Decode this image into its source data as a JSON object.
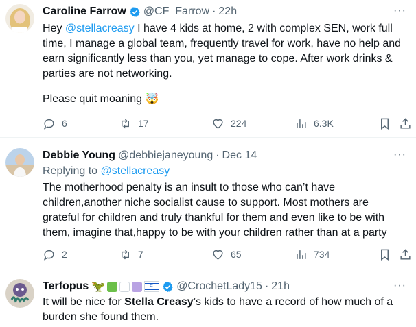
{
  "tweets": [
    {
      "name": "Caroline Farrow",
      "handle": "@CF_Farrow",
      "sep": "·",
      "time": "22h",
      "reply_to_prefix": "",
      "reply_to": "",
      "line_1_prefix": "Hey ",
      "line_1_mention": "@stellacreasy",
      "line_1_rest": " I have 4 kids at home, 2 with complex SEN, work full time, I manage a global team, frequently travel for work, have no help and earn significantly less than you, yet manage to cope. After work drinks & parties are not networking.",
      "line_2": "Please quit moaning",
      "line_2_emoji": "🤯",
      "replies": "6",
      "reposts": "17",
      "likes": "224",
      "views": "6.3K",
      "avatar_colors": [
        "#e8d9b0",
        "#c9a16a"
      ]
    },
    {
      "name": "Debbie Young",
      "handle": "@debbiejaneyoung",
      "sep": "·",
      "time": "Dec 14",
      "reply_to_prefix": "Replying to ",
      "reply_to": "@stellacreasy",
      "text": "The motherhood penalty is an insult to those who can’t have children,another niche socialist cause to support. Most mothers are grateful for children and truly thankful for them and even like to be with them, imagine that,happy to be with your children rather than at a party",
      "replies": "2",
      "reposts": "7",
      "likes": "65",
      "views": "734",
      "avatar_colors": [
        "#9bb9d8",
        "#e3c7a7"
      ]
    },
    {
      "name": "Terfopus",
      "name_emojis": [
        "🦖"
      ],
      "handle": "@CrochetLady15",
      "sep": "·",
      "time": "21h",
      "text_prefix": "It will be nice for ",
      "text_bold": "Stella Creasy",
      "text_rest": "’s kids to have a record of how much of a burden she found them.",
      "avatar_colors": [
        "#6b5a8e",
        "#2f7d6d"
      ]
    }
  ],
  "more_label": "···",
  "colors": {
    "accent": "#1d9bf0",
    "muted": "#536471",
    "text": "#0f1419",
    "divider": "#eff3f4",
    "name_square_1": "#6cc04a",
    "name_square_2": "#ffffff",
    "name_square_3": "#b9a3e3"
  },
  "icons": [
    "verified-badge-icon",
    "reply-icon",
    "repost-icon",
    "like-icon",
    "views-icon",
    "bookmark-icon",
    "share-icon",
    "more-icon",
    "israel-flag-icon"
  ]
}
